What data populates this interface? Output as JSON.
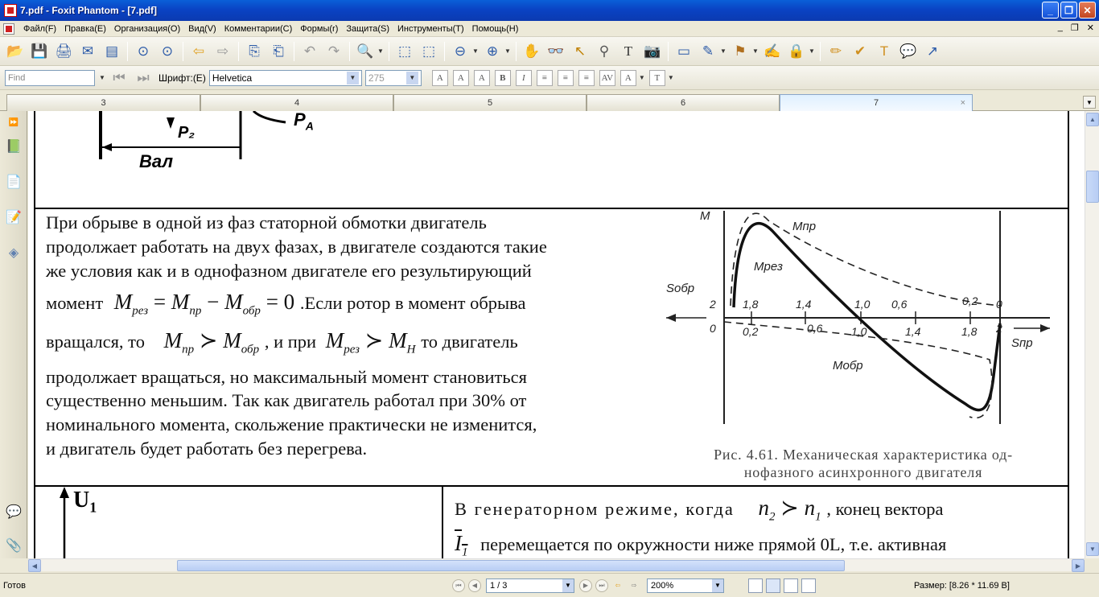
{
  "window": {
    "title": "7.pdf - Foxit Phantom - [7.pdf]",
    "min": "_",
    "max": "❐",
    "close": "✕"
  },
  "menu": [
    "Файл(F)",
    "Правка(E)",
    "Организация(O)",
    "Вид(V)",
    "Комментарии(C)",
    "Формы(r)",
    "Защита(S)",
    "Инструменты(T)",
    "Помощь(H)"
  ],
  "mdi": {
    "min": "_",
    "restore": "❐",
    "close": "✕"
  },
  "toolbar2": {
    "find_placeholder": "Find",
    "font_label": "Шрифт:(E)",
    "font_value": "Helvetica",
    "size_value": "275"
  },
  "tabs": [
    {
      "label": "3"
    },
    {
      "label": "4"
    },
    {
      "label": "5"
    },
    {
      "label": "6"
    },
    {
      "label": "7",
      "active": true,
      "close": "×"
    }
  ],
  "document": {
    "diagram_top": {
      "label_p2": "P₂",
      "label_pa": "P",
      "label_pa_sub": "А",
      "label_val": "Вал"
    },
    "para1_lines": [
      "При обрыве в одной из фаз статорной обмотки двигатель",
      "продолжает работать на двух фазах, в двигателе создаются такие",
      "же условия как и в однофазном двигателе его результирующий"
    ],
    "para1_line4_pre": "момент",
    "para1_line4_post": ".Если ротор в момент обрыва",
    "eq1": {
      "m": "M",
      "rez": "рез",
      "eq": "=",
      "pr": "пр",
      "minus": "−",
      "obr": "обр",
      "zero": "= 0"
    },
    "para1_line5_pre": "вращался, то",
    "para1_line5_mid": ", и при",
    "para1_line5_post": "то двигатель",
    "eq2": {
      "m": "M",
      "pr": "пр",
      "succ": "≻",
      "obr": "обр",
      "rez": "рез",
      "h": "Н"
    },
    "para1_rest": [
      "продолжает вращаться, но максимальный момент становиться",
      "существенно меньшим. Так как двигатель работал при 30% от",
      "номинального момента, скольжение практически не изменится,",
      "и двигатель будет работать без перегрева."
    ],
    "figure": {
      "axis_m": "M",
      "m_pr": "Mпр",
      "m_rez": "Mрез",
      "m_obr": "Mобр",
      "s_obr": "Sобр",
      "s_pr": "Sпр",
      "ticks_top": [
        "2",
        "1,8",
        "1,4",
        "1,0",
        "0,6",
        "0,2",
        "0"
      ],
      "ticks_bottom": [
        "0",
        "0,2",
        "0,6",
        "1,0",
        "1,4",
        "1,8",
        "2"
      ],
      "caption_line1": "Рис. 4.61. Механическая характеристика од-",
      "caption_line2": "нофазного асинхронного двигателя"
    },
    "bottom_left_label": "U",
    "bottom_left_sub": "1",
    "bottom_right_line1_pre": "В генераторном режиме, когда",
    "bottom_right_line1_post": ", конец вектора",
    "eq3": {
      "n2": "n",
      "sub2": "2",
      "succ": "≻",
      "n1": "n",
      "sub1": "1"
    },
    "bottom_right_line2_vec": "I",
    "bottom_right_line2_sub": "1",
    "bottom_right_line2_post": "перемещается по окружности ниже прямой 0L, т.е. активная"
  },
  "status": {
    "ready": "Готов",
    "page": "1 / 3",
    "zoom": "200%",
    "size": "Размер: [8.26 * 11.69 В]"
  }
}
